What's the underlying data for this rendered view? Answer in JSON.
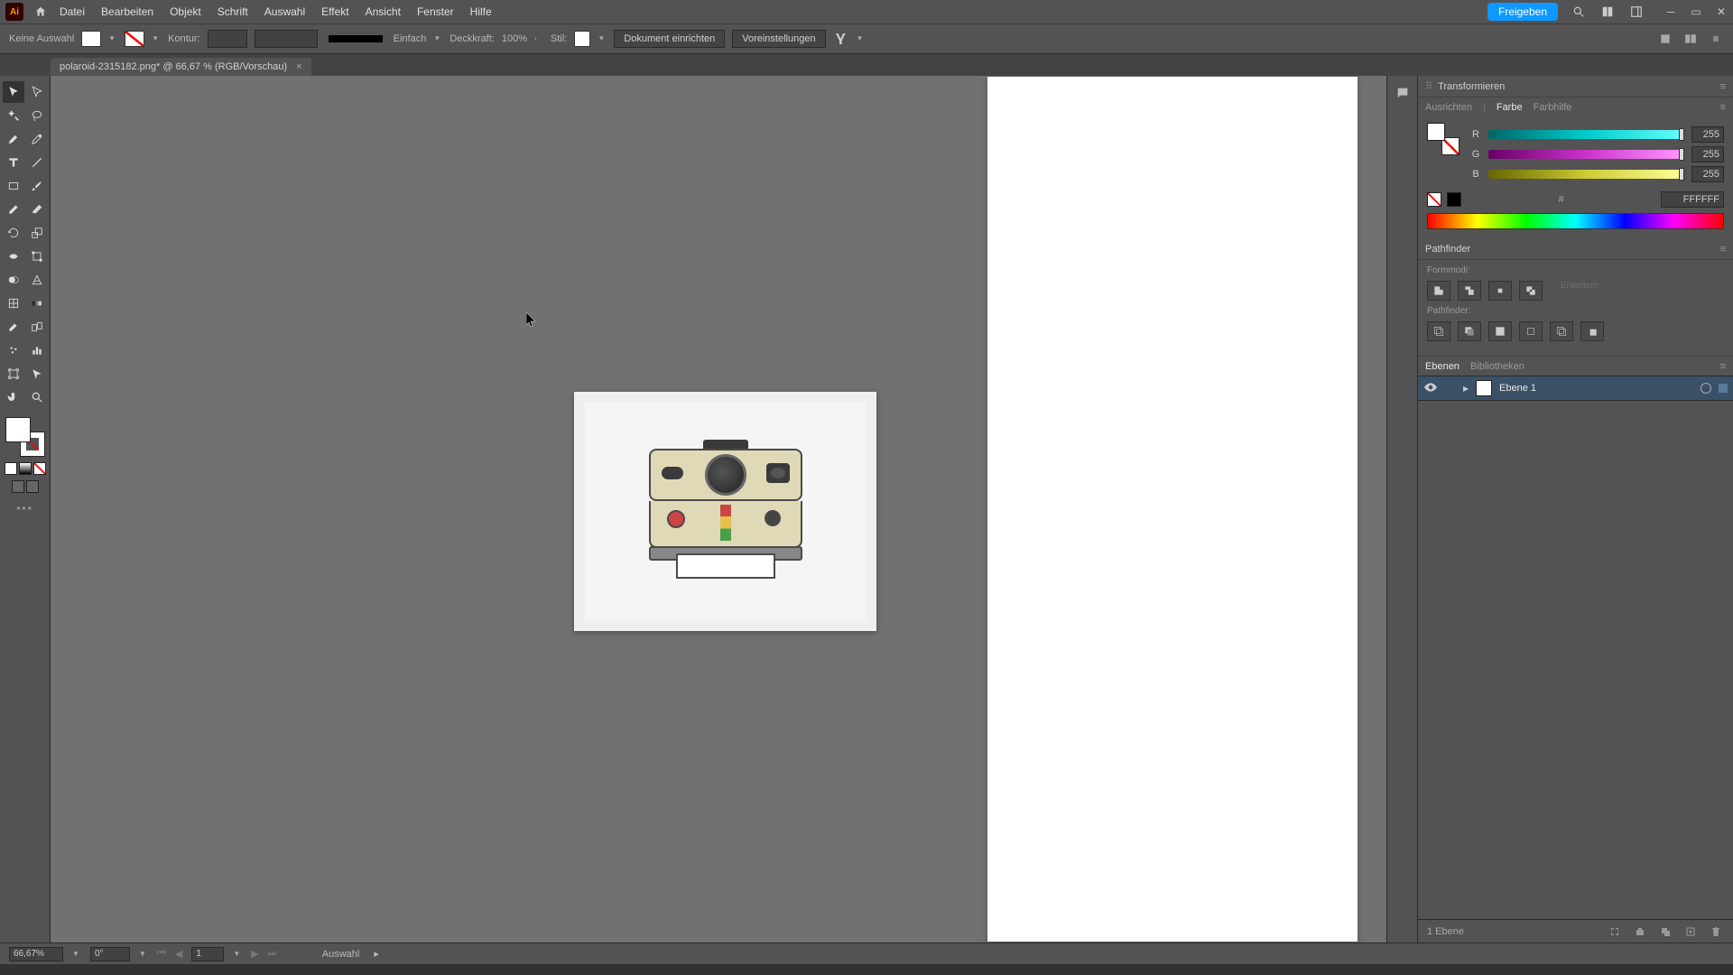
{
  "menu": {
    "items": [
      "Datei",
      "Bearbeiten",
      "Objekt",
      "Schrift",
      "Auswahl",
      "Effekt",
      "Ansicht",
      "Fenster",
      "Hilfe"
    ],
    "share": "Freigeben"
  },
  "control": {
    "selection": "Keine Auswahl",
    "kontur_label": "Kontur:",
    "stroke_style": "Einfach",
    "opacity_label": "Deckkraft:",
    "opacity_value": "100%",
    "style_label": "Stil:",
    "doc_setup": "Dokument einrichten",
    "preferences": "Voreinstellungen"
  },
  "tab": {
    "title": "polaroid-2315182.png* @ 66,67 % (RGB/Vorschau)",
    "close": "×"
  },
  "panels": {
    "transform": "Transformieren",
    "align": "Ausrichten",
    "color": "Farbe",
    "color_guide": "Farbhilfe",
    "r_label": "R",
    "g_label": "G",
    "b_label": "B",
    "r_val": "255",
    "g_val": "255",
    "b_val": "255",
    "hex_prefix": "#",
    "hex_value": "FFFFFF",
    "pathfinder": "Pathfinder",
    "formmodi": "Formmodi:",
    "erweitern": "Erweitern",
    "pathfinder_label": "Pathfinder:",
    "layers": "Ebenen",
    "libraries": "Bibliotheken",
    "layer1_name": "Ebene 1"
  },
  "status": {
    "zoom": "66,67%",
    "rotation": "0°",
    "artboard_num": "1",
    "tool": "Auswahl",
    "layer_count": "1 Ebene"
  }
}
